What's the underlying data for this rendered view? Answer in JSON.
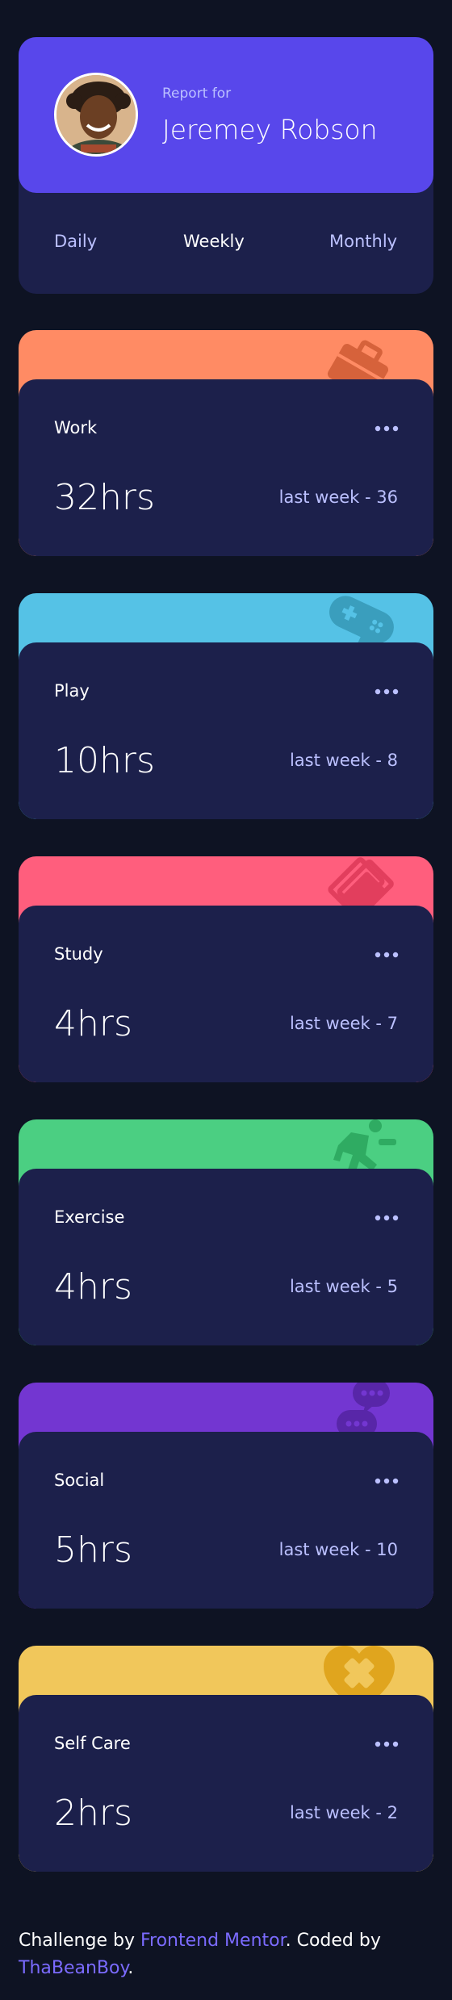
{
  "profile": {
    "report_for": "Report for",
    "name": "Jeremey Robson",
    "accent": "#5847eb"
  },
  "tabs": [
    {
      "label": "Daily",
      "active": false
    },
    {
      "label": "Weekly",
      "active": true
    },
    {
      "label": "Monthly",
      "active": false
    }
  ],
  "activities": [
    {
      "title": "Work",
      "hours": "32hrs",
      "previous": "last week - 36",
      "color": "#ff8b64",
      "icon": "briefcase-icon"
    },
    {
      "title": "Play",
      "hours": "10hrs",
      "previous": "last week - 8",
      "color": "#55c2e6",
      "icon": "gamepad-icon"
    },
    {
      "title": "Study",
      "hours": "4hrs",
      "previous": "last week - 7",
      "color": "#ff5e7d",
      "icon": "book-icon"
    },
    {
      "title": "Exercise",
      "hours": "4hrs",
      "previous": "last week - 5",
      "color": "#4bcf82",
      "icon": "running-icon"
    },
    {
      "title": "Social",
      "hours": "5hrs",
      "previous": "last week - 10",
      "color": "#7336d1",
      "icon": "chat-icon"
    },
    {
      "title": "Self Care",
      "hours": "2hrs",
      "previous": "last week - 2",
      "color": "#f1c75b",
      "icon": "heart-icon"
    }
  ],
  "footer": {
    "prefix": "Challenge by ",
    "link1": "Frontend Mentor",
    "middle": ". Coded by ",
    "link2": "ThaBeanBoy",
    "suffix": "."
  }
}
